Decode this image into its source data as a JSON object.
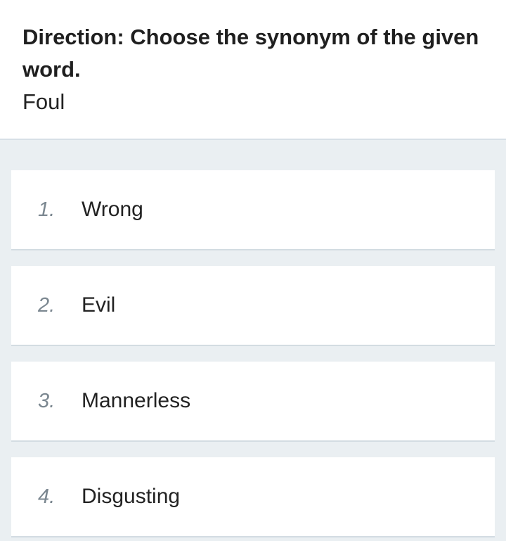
{
  "question": {
    "direction": "Direction: Choose the synonym of the given word.",
    "word": "Foul"
  },
  "options": [
    {
      "number": "1.",
      "label": "Wrong"
    },
    {
      "number": "2.",
      "label": "Evil"
    },
    {
      "number": "3.",
      "label": "Mannerless"
    },
    {
      "number": "4.",
      "label": "Disgusting"
    }
  ]
}
